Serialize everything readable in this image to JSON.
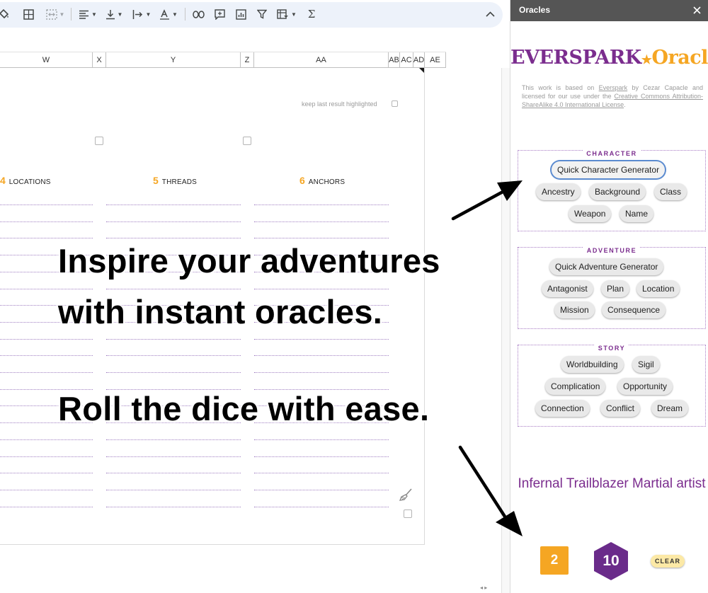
{
  "toolbar": {
    "sum_symbol": "Σ"
  },
  "columns": [
    "W",
    "X",
    "Y",
    "Z",
    "AA",
    "AB",
    "AC",
    "AD",
    "AE"
  ],
  "sheet": {
    "keep_label": "keep last result highlighted",
    "sections": [
      {
        "num": "4",
        "label": "LOCATIONS"
      },
      {
        "num": "5",
        "label": "THREADS"
      },
      {
        "num": "6",
        "label": "ANCHORS"
      }
    ]
  },
  "overlay": {
    "line1": "Inspire your adventures",
    "line2": "with instant oracles.",
    "line3": "Roll the dice with ease."
  },
  "panel": {
    "title": "Oracles",
    "logo_part1": "EVERSPARK",
    "logo_star": "★",
    "logo_part2": "Oracles",
    "license": {
      "t1": "This work is based on ",
      "link1": "Everspark",
      "t2": " by Cezar Capacle and licensed for our use under the ",
      "link2": "Creative Commons Attribution-ShareAlike 4.0 International License",
      "t3": "."
    },
    "groups": {
      "character": {
        "label": "CHARACTER",
        "buttons": [
          "Quick Character Generator",
          "Ancestry",
          "Background",
          "Class",
          "Weapon",
          "Name"
        ]
      },
      "adventure": {
        "label": "ADVENTURE",
        "buttons": [
          "Quick Adventure Generator",
          "Antagonist",
          "Plan",
          "Location",
          "Mission",
          "Consequence"
        ]
      },
      "story": {
        "label": "STORY",
        "buttons": [
          "Worldbuilding",
          "Sigil",
          "Complication",
          "Opportunity",
          "Connection",
          "Conflict",
          "Dream"
        ]
      }
    },
    "result": "Infernal Trailblazer Martial artist",
    "dice": {
      "d6": "2",
      "d10": "10"
    },
    "clear_label": "CLEAR"
  },
  "colors": {
    "brand_purple": "#7b2d8e",
    "brand_orange": "#f5a623",
    "panel_header": "#555555"
  }
}
